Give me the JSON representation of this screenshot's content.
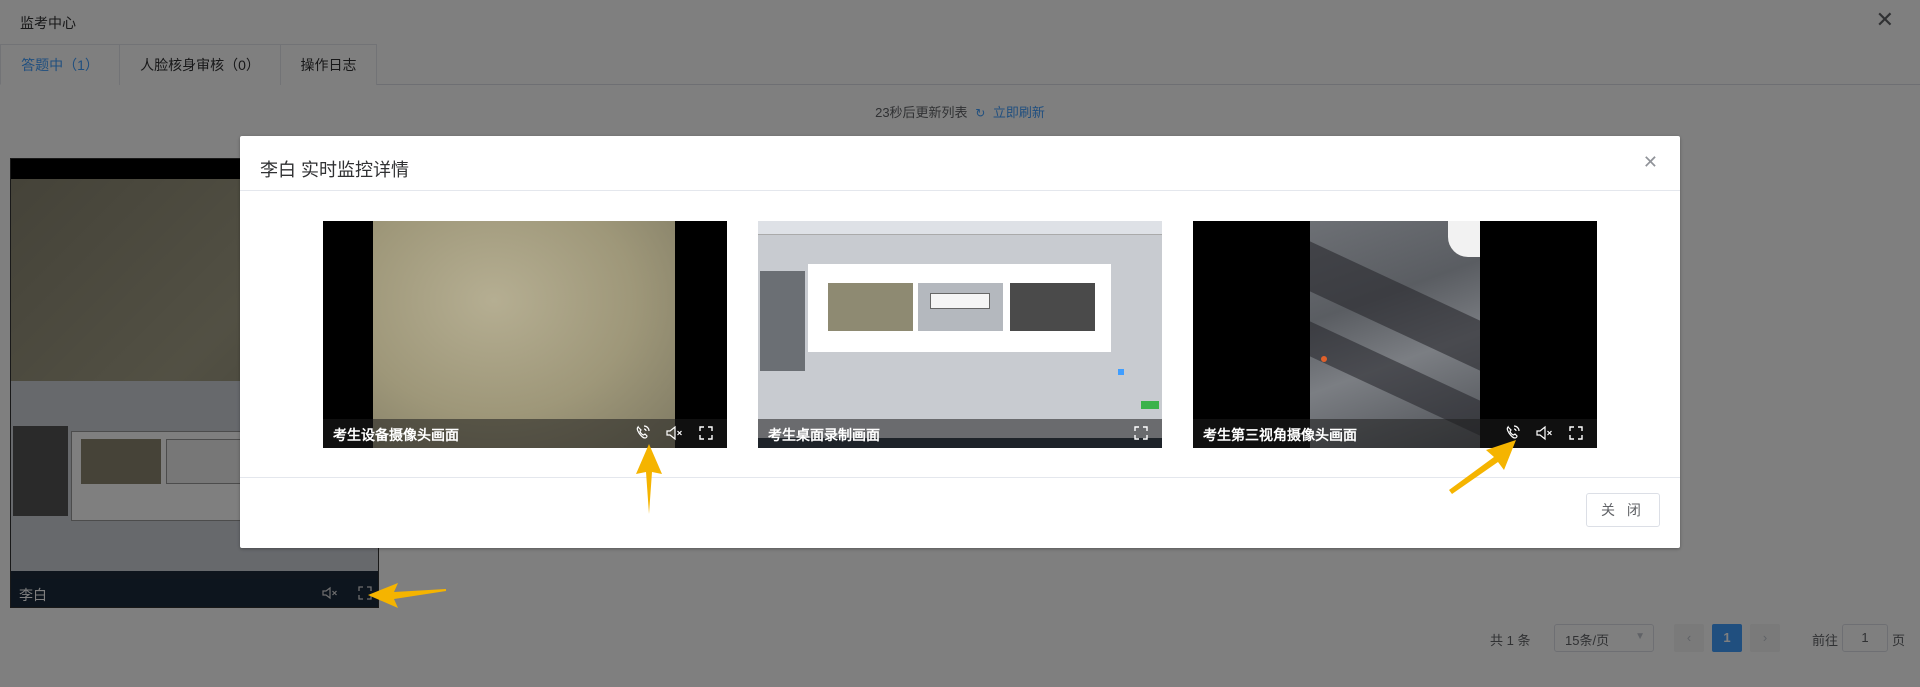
{
  "page": {
    "title": "监考中心",
    "close_glyph": "✕"
  },
  "tabs": [
    {
      "label": "答题中（1）",
      "active": true
    },
    {
      "label": "人脸核身审核（0）",
      "active": false
    },
    {
      "label": "操作日志",
      "active": false
    }
  ],
  "refresh": {
    "countdown_text": "23秒后更新列表",
    "refresh_icon": "refresh-icon",
    "link_label": "立即刷新"
  },
  "student_card": {
    "name": "李白",
    "icons": [
      "mute-icon",
      "fullscreen-icon"
    ]
  },
  "pagination": {
    "total": "共 1 条",
    "page_size": "15条/页",
    "prev_glyph": "‹",
    "current_page": "1",
    "next_glyph": "›",
    "goto_label": "前往",
    "goto_value": "1",
    "goto_suffix": "页"
  },
  "dialog": {
    "title": "李白 实时监控详情",
    "close_glyph": "✕",
    "close_button_label": "关 闭",
    "videos": [
      {
        "label": "考生设备摄像头画面",
        "controls": [
          "call-icon",
          "mute-icon",
          "fullscreen-icon"
        ]
      },
      {
        "label": "考生桌面录制画面",
        "controls": [
          "fullscreen-icon"
        ]
      },
      {
        "label": "考生第三视角摄像头画面",
        "controls": [
          "call-icon",
          "mute-icon",
          "fullscreen-icon"
        ]
      }
    ]
  },
  "colors": {
    "accent": "#409eff",
    "arrow": "#f5b400",
    "mask": "rgba(0,0,0,0.5)"
  }
}
